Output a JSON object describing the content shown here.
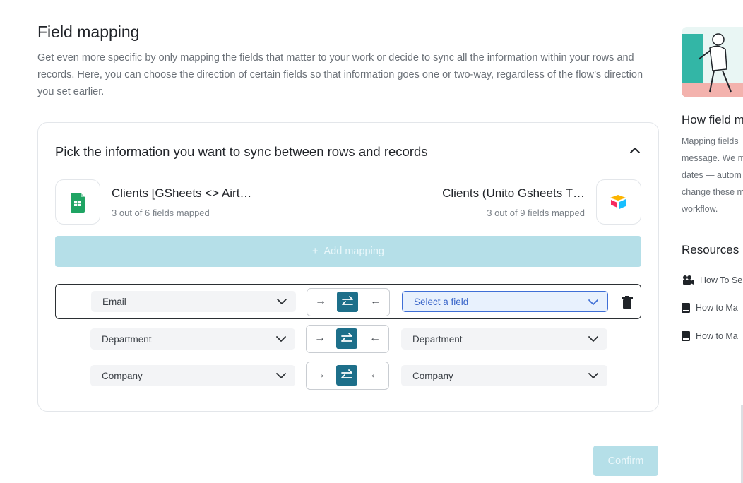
{
  "page": {
    "title": "Field mapping",
    "description": "Get even more specific by only mapping the fields that matter to your work or decide to sync all the information within your rows and records. Here, you can choose the direction of certain fields so that information goes one or two-way, regardless of the flow’s direction you set earlier."
  },
  "card": {
    "heading": "Pick the information you want to sync between rows and records",
    "left_app": {
      "name": "Clients [GSheets <> Airt…",
      "fields": "3 out of 6 fields mapped",
      "icon": "google-sheets-icon"
    },
    "right_app": {
      "name": "Clients (Unito Gsheets T…",
      "fields": "3 out of 9 fields mapped",
      "icon": "airtable-icon"
    },
    "add_mapping": "Add mapping",
    "mappings": [
      {
        "left": "Email",
        "right": "Select a field",
        "direction": "two-way",
        "active": true
      },
      {
        "left": "Department",
        "right": "Department",
        "direction": "two-way",
        "active": false
      },
      {
        "left": "Company",
        "right": "Company",
        "direction": "two-way",
        "active": false
      }
    ],
    "arrow_right": "→",
    "arrow_left": "←"
  },
  "confirm_label": "Confirm",
  "sidebar": {
    "title": "How field m",
    "text_lines": [
      "Mapping fields",
      "message. We m",
      "dates — autom",
      "change these m",
      "workflow."
    ],
    "resources_title": "Resources",
    "resources": [
      {
        "label": "How To Se",
        "icon": "video-camera-icon"
      },
      {
        "label": "How to Ma",
        "icon": "book-icon"
      },
      {
        "label": "How to Ma",
        "icon": "book-icon"
      }
    ]
  },
  "colors": {
    "accent": "#1d6f8a",
    "disabled_button": "#b5dfe8",
    "focus_border": "#3f6fd6"
  }
}
